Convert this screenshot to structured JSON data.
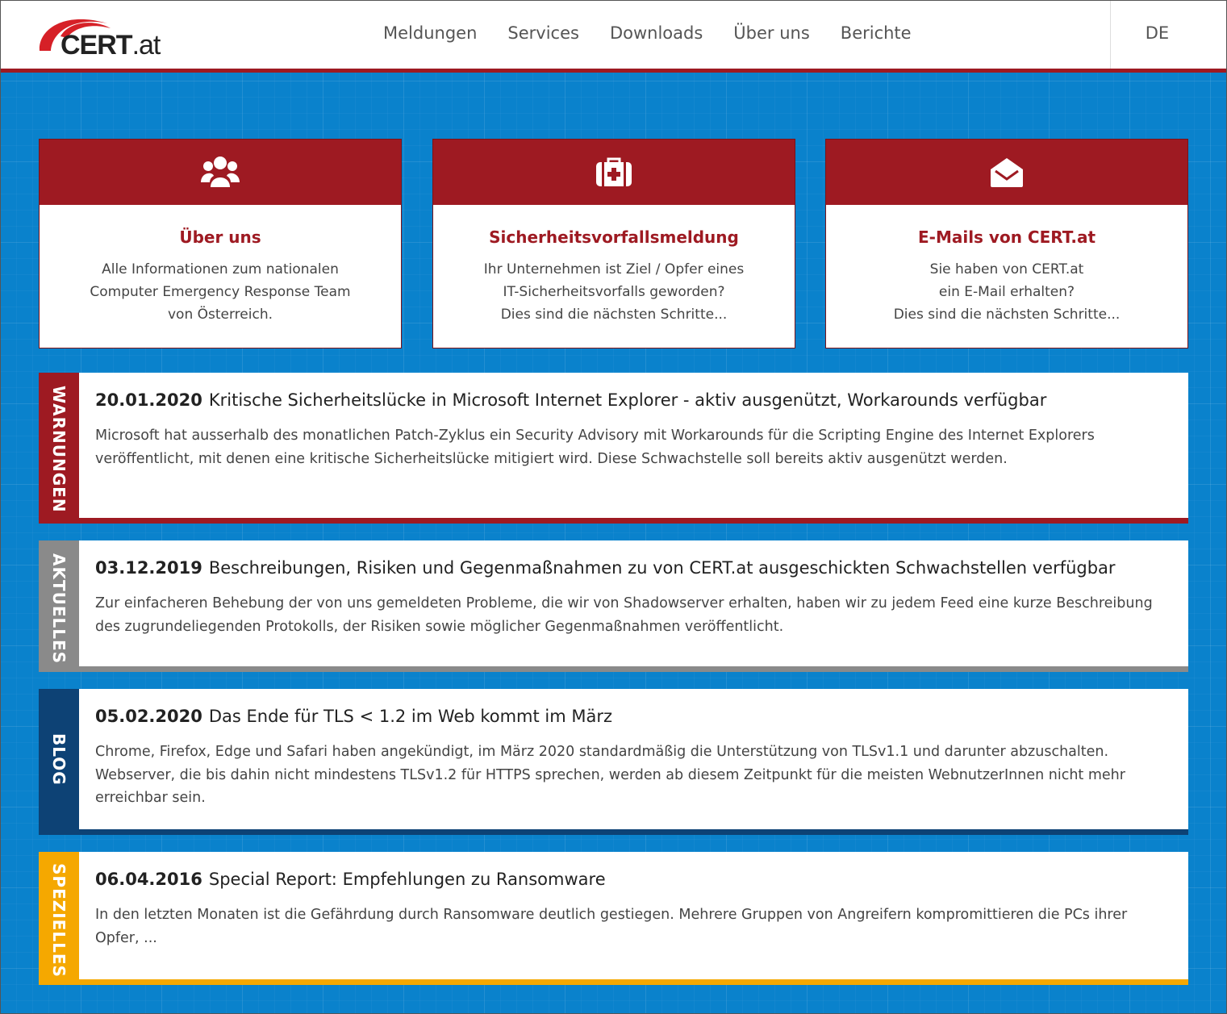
{
  "header": {
    "logo_text": "CERT",
    "logo_tld": ".at",
    "nav": [
      "Meldungen",
      "Services",
      "Downloads",
      "Über uns",
      "Berichte"
    ],
    "language": "DE"
  },
  "cards": [
    {
      "icon": "users-icon",
      "title": "Über uns",
      "lines": [
        "Alle Informationen zum nationalen",
        "Computer Emergency Response Team",
        "von Österreich."
      ]
    },
    {
      "icon": "first-aid-kit-icon",
      "title": "Sicherheitsvorfallsmeldung",
      "lines": [
        "Ihr Unternehmen ist Ziel / Opfer eines",
        "IT-Sicherheitsvorfalls geworden?",
        "Dies sind die nächsten Schritte..."
      ]
    },
    {
      "icon": "envelope-open-icon",
      "title": "E-Mails von CERT.at",
      "lines": [
        "Sie haben von CERT.at",
        "ein E-Mail erhalten?",
        "Dies sind die nächsten Schritte..."
      ]
    }
  ],
  "sections": [
    {
      "label": "WARNUNGEN",
      "color": "#9e1a22",
      "date": "20.01.2020",
      "title": "Kritische Sicherheitslücke in Microsoft Internet Explorer - aktiv ausgenützt, Workarounds verfügbar",
      "lines": [
        "Microsoft hat ausserhalb des monatlichen Patch-Zyklus ein Security Advisory mit Workarounds für die Scripting Engine des Internet Explorers",
        "veröffentlicht, mit denen eine kritische Sicherheitslücke mitigiert wird. Diese Schwachstelle soll bereits aktiv ausgenützt werden."
      ]
    },
    {
      "label": "AKTUELLES",
      "color": "#8a8a8a",
      "date": "03.12.2019",
      "title": "Beschreibungen, Risiken und Gegenmaßnahmen zu von CERT.at ausgeschickten Schwachstellen verfügbar",
      "lines": [
        "Zur einfacheren Behebung der von uns gemeldeten Probleme, die wir von Shadowserver erhalten, haben wir zu jedem Feed eine kurze Beschreibung",
        "des zugrundeliegenden Protokolls, der Risiken sowie möglicher Gegenmaßnahmen veröffentlicht."
      ]
    },
    {
      "label": "BLOG",
      "color": "#0d4275",
      "date": "05.02.2020",
      "title": "Das Ende für TLS < 1.2 im Web kommt im März",
      "lines": [
        "Chrome, Firefox, Edge und Safari haben angekündigt, im März 2020 standardmäßig die Unterstützung von TLSv1.1 und darunter abzuschalten.",
        "Webserver, die bis dahin nicht mindestens TLSv1.2 für HTTPS sprechen, werden ab diesem Zeitpunkt für die meisten WebnutzerInnen nicht mehr",
        "erreichbar sein."
      ]
    },
    {
      "label": "SPEZIELLES",
      "color": "#f5a800",
      "date": "06.04.2016",
      "title": "Special Report: Empfehlungen zu Ransomware",
      "lines": [
        "In den letzten Monaten ist die Gefährdung durch Ransomware deutlich gestiegen. Mehrere Gruppen von Angreifern kompromittieren die PCs ihrer",
        "Opfer, ..."
      ]
    }
  ]
}
